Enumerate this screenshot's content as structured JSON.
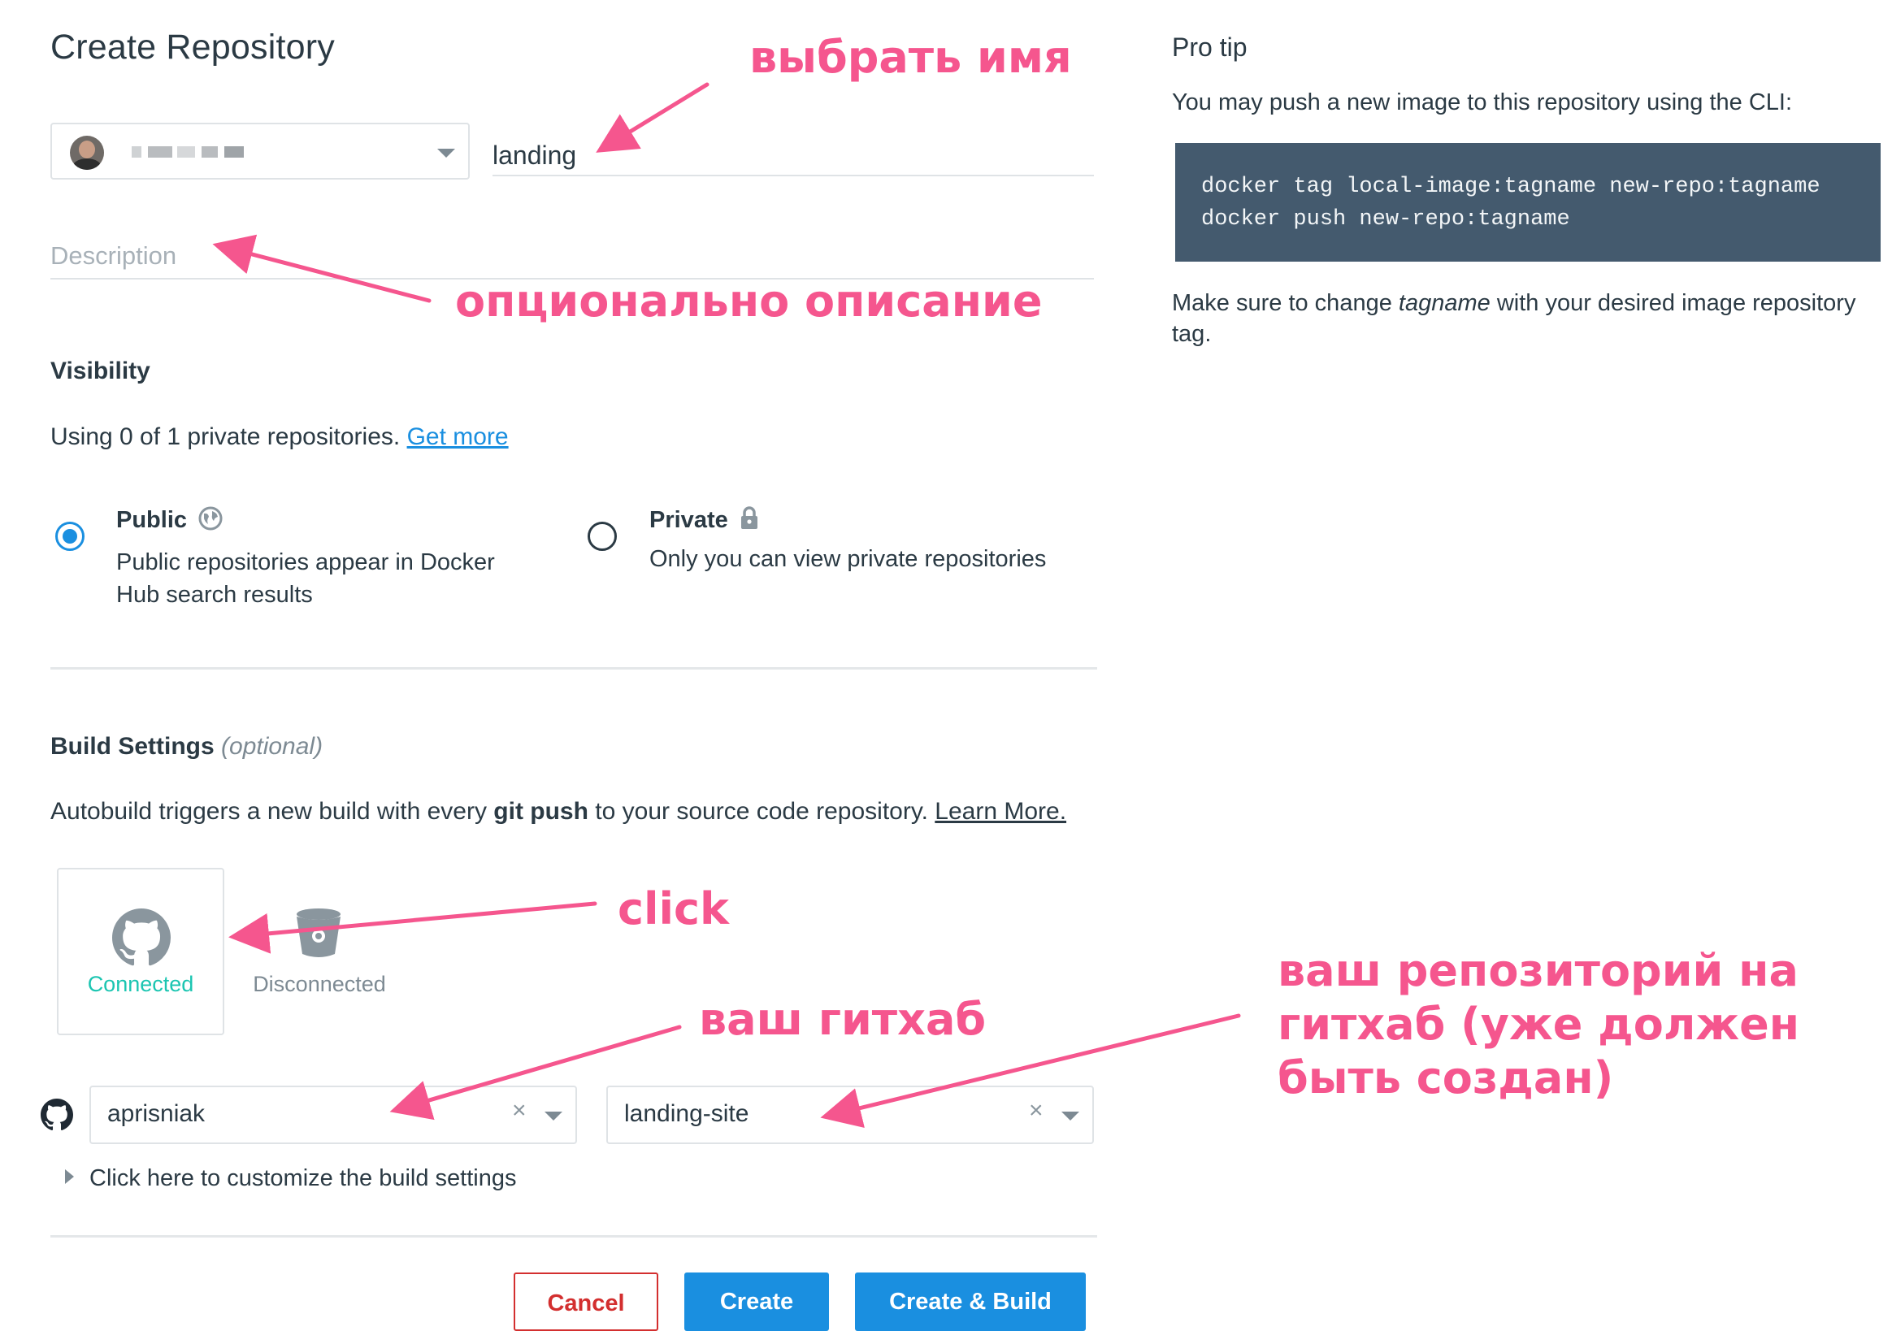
{
  "page": {
    "title": "Create Repository"
  },
  "namespace": {
    "avatar": "user-avatar",
    "value_redacted": true
  },
  "repo_name": {
    "value": "landing"
  },
  "description": {
    "placeholder": "Description"
  },
  "visibility": {
    "heading": "Visibility",
    "usage_text": "Using 0 of 1 private repositories.",
    "get_more": "Get more",
    "public": {
      "label": "Public",
      "desc_line1": "Public repositories appear in Docker",
      "desc_line2": "Hub search results",
      "selected": true,
      "icon": "globe-icon"
    },
    "private": {
      "label": "Private",
      "desc": "Only you can view private repositories",
      "selected": false,
      "icon": "lock-icon"
    }
  },
  "build": {
    "heading": "Build Settings",
    "optional": "(optional)",
    "desc_pre": "Autobuild triggers a new build with every",
    "desc_bold": "git push",
    "desc_post": "to your source code repository.",
    "learn_more": "Learn More.",
    "providers": [
      {
        "name": "github",
        "status": "Connected",
        "color": "#1bc5b1"
      },
      {
        "name": "bitbucket",
        "status": "Disconnected",
        "color": "#7d8a93"
      }
    ],
    "org_select": "aprisniak",
    "repo_select": "landing-site",
    "customize": "Click here to customize the build settings"
  },
  "buttons": {
    "cancel": "Cancel",
    "create": "Create",
    "create_build": "Create & Build"
  },
  "pro_tip": {
    "heading": "Pro tip",
    "intro": "You may push a new image to this repository using the CLI:",
    "code_line1": "docker tag local-image:tagname new-repo:tagname",
    "code_line2": "docker push new-repo:tagname",
    "note_pre": "Make sure to change",
    "note_em": "tagname",
    "note_post": "with your desired image repository",
    "note_line2": "tag."
  },
  "annotations": {
    "name": "выбрать имя",
    "description": "опционально описание",
    "click": "click",
    "github": "ваш гитхаб",
    "repo_line1": "ваш репозиторий на",
    "repo_line2": "гитхаб (уже должен",
    "repo_line3": "быть создан)",
    "color": "#f5568e"
  },
  "colors": {
    "accent": "#1a8fe0",
    "danger": "#d32f2f",
    "code_bg": "#445a6e",
    "connected": "#1bc5b1"
  }
}
